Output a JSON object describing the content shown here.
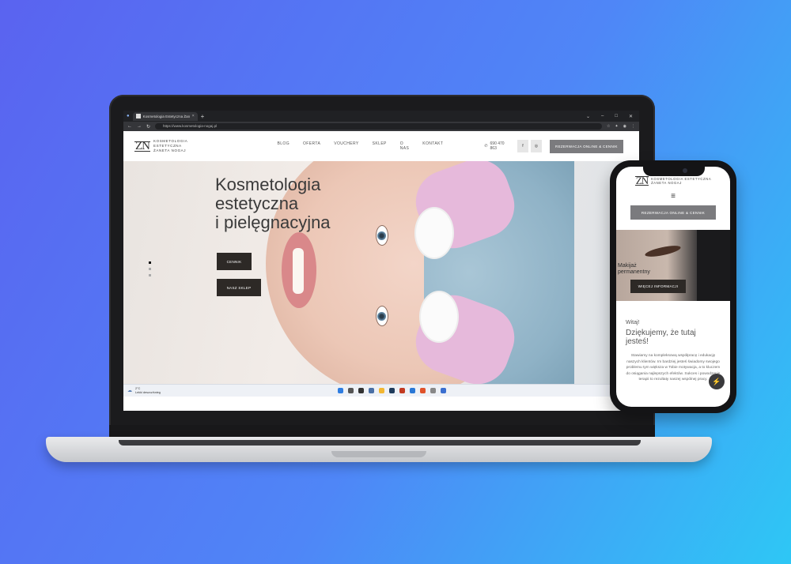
{
  "browser": {
    "tab_title": "Kosmetologia Estetyczna Żan",
    "tab_close": "×",
    "new_tab": "+",
    "url": "https://www.kosmetologia-nogaj.pl"
  },
  "site": {
    "logo_mark": "ZN",
    "logo_line1": "KOSMETOLOGIA ESTETYCZNA",
    "logo_line2": "ŻANETA NOGAJ",
    "menu": [
      "BLOG",
      "OFERTA",
      "VOUCHERY",
      "SKLEP",
      "O NAS",
      "KONTAKT"
    ],
    "phone": "690 470 863",
    "social": [
      "f",
      "◎"
    ],
    "reserve_label": "REZERWACJA ONLINE & CENNIK",
    "hero_title": [
      "Kosmetologia",
      "estetyczna",
      "i pielęgnacyjna"
    ],
    "hero_buttons": [
      "CENNIK",
      "NASZ SKLEP"
    ]
  },
  "taskbar": {
    "temp": "2°C",
    "weather": "Lekki deszcz/śnieg"
  },
  "mobile": {
    "logo_mark": "ZN",
    "logo_line1": "KOSMETOLOGIA ESTETYCZNA",
    "logo_line2": "ŻANETA NOGAJ",
    "menu_icon": "≡",
    "reserve_label": "REZERWACJA ONLINE & CENNIK",
    "hero_title_1": "Makijaż",
    "hero_title_2": "permanentny",
    "more_label": "WIĘCEJ INFORMACJI",
    "hello": "Witaj!",
    "thanks": "Dziękujemy, że tutaj jesteś!",
    "paragraph": "Stawiamy na kompleksową współpracę i edukację naszych klientów. Im bardziej jesteś świadomy swojego problemu tym większa w Tobie motywacja, a to kluczem do osiągania najlepszych efektów. Sukces i powodzenie terapii to rezultaty naszej wspólnej pracy."
  },
  "colors": {
    "background_start": "#5a63f0",
    "background_end": "#2ec7f5",
    "button_dark": "#2d2926",
    "button_grey": "#7b7b7e"
  }
}
